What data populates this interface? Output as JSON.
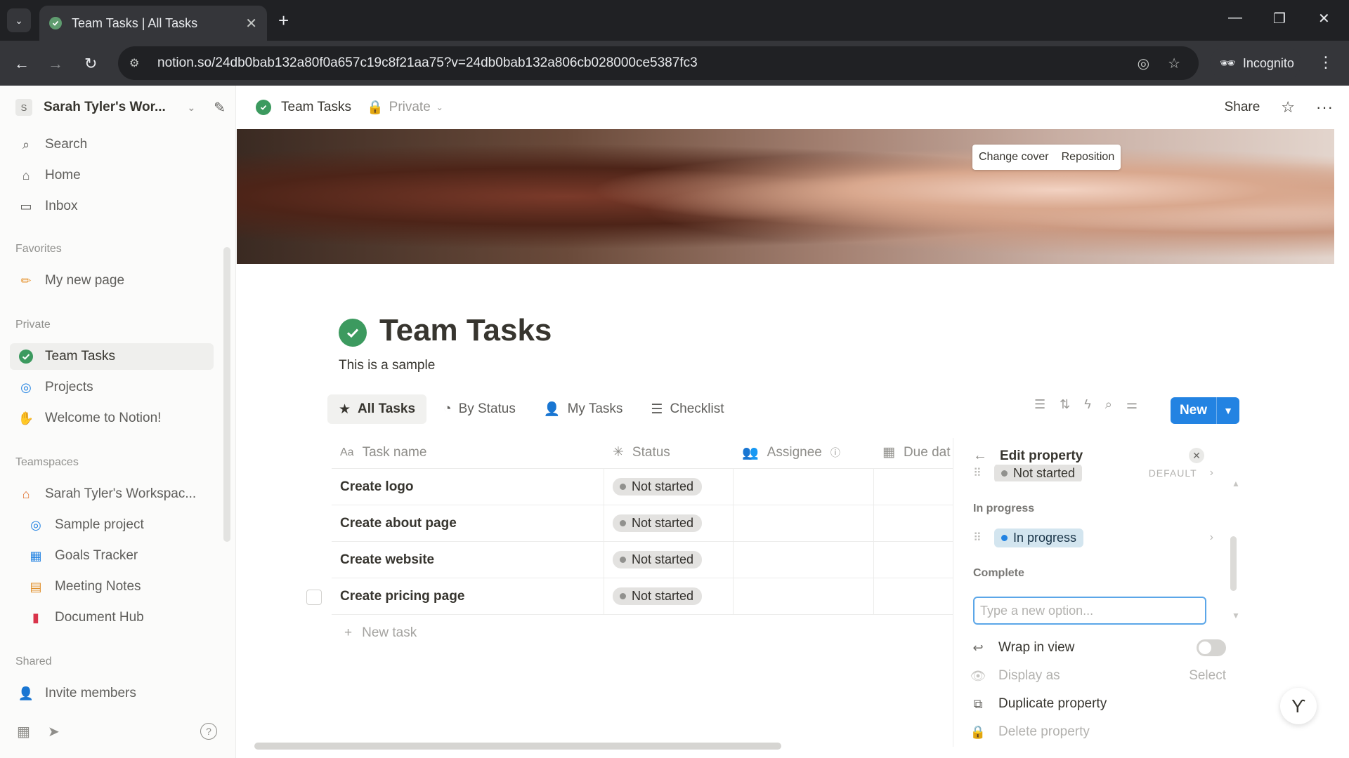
{
  "browser": {
    "tab_title": "Team Tasks | All Tasks",
    "new_tab": "+",
    "url": "notion.so/24db0bab132a80f0a657c19c8f21aa75?v=24db0bab132a806cb028000ce5387fc3",
    "incognito": "Incognito"
  },
  "sidebar": {
    "workspace": "Sarah Tyler's Wor...",
    "workspace_initial": "S",
    "nav": {
      "search": "Search",
      "home": "Home",
      "inbox": "Inbox"
    },
    "favorites_label": "Favorites",
    "favorites": [
      "My new page"
    ],
    "private_label": "Private",
    "private": [
      "Team Tasks",
      "Projects",
      "Welcome to Notion!"
    ],
    "teamspaces_label": "Teamspaces",
    "teamspace": "Sarah Tyler's Workspac...",
    "teamspace_items": [
      "Sample project",
      "Goals Tracker",
      "Meeting Notes",
      "Document Hub"
    ],
    "shared_label": "Shared",
    "invite": "Invite members"
  },
  "topbar": {
    "page": "Team Tasks",
    "visibility": "Private",
    "share": "Share"
  },
  "cover": {
    "change": "Change cover",
    "reposition": "Reposition"
  },
  "page": {
    "title": "Team Tasks",
    "description": "This is a sample"
  },
  "views": [
    "All Tasks",
    "By Status",
    "My Tasks",
    "Checklist"
  ],
  "new_button": "New",
  "table": {
    "headers": {
      "name": "Task name",
      "status": "Status",
      "assignee": "Assignee",
      "due": "Due dat"
    },
    "rows": [
      {
        "name": "Create logo",
        "status": "Not started"
      },
      {
        "name": "Create about page",
        "status": "Not started"
      },
      {
        "name": "Create website",
        "status": "Not started"
      },
      {
        "name": "Create pricing page",
        "status": "Not started"
      }
    ],
    "new_task": "New task"
  },
  "edit_property": {
    "title": "Edit property",
    "options": {
      "not_started": "Not started",
      "default_tag": "DEFAULT",
      "in_progress_group": "In progress",
      "in_progress": "In progress",
      "complete_group": "Complete"
    },
    "input_placeholder": "Type a new option...",
    "menu": {
      "wrap": "Wrap in view",
      "display_as": "Display as",
      "display_value": "Select",
      "duplicate": "Duplicate property",
      "delete": "Delete property"
    }
  },
  "colors": {
    "accent": "#2383e2",
    "check_green": "#3c9a5f",
    "in_progress_blue": "#d3e5ef",
    "not_started_gray": "#e3e2e0"
  }
}
